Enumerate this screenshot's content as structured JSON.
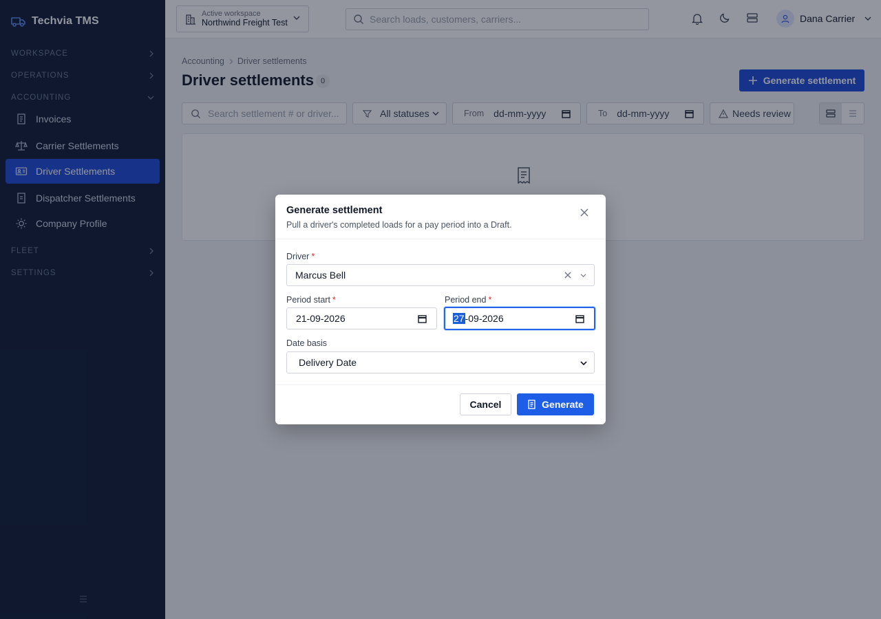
{
  "app": {
    "brand": "Techvia TMS"
  },
  "sidebar": {
    "sections": {
      "workspace": "WORKSPACE",
      "operations": "OPERATIONS",
      "accounting": "ACCOUNTING",
      "fleet": "FLEET",
      "settings": "SETTINGS"
    },
    "items": [
      {
        "label": "Invoices",
        "icon": "invoice-icon"
      },
      {
        "label": "Carrier Settlements",
        "icon": "scale-icon"
      },
      {
        "label": "Driver Settlements",
        "icon": "id-card-icon",
        "active": true
      },
      {
        "label": "Dispatcher Settlements",
        "icon": "document-icon"
      },
      {
        "label": "Company Profile",
        "icon": "sun-icon"
      }
    ]
  },
  "topbar": {
    "workspace_label": "Active workspace",
    "workspace_name": "Northwind Freight Test",
    "search_placeholder": "Search loads, customers, carriers...",
    "user_name": "Dana Carrier"
  },
  "page": {
    "breadcrumb": [
      "Accounting",
      "Driver settlements"
    ],
    "title": "Driver settlements",
    "count": "0",
    "generate_button": "Generate settlement",
    "filters": {
      "search_placeholder": "Search settlement # or driver...",
      "status": "All statuses",
      "from_label": "From",
      "from_value": "dd-mm-yyyy",
      "to_label": "To",
      "to_value": "dd-mm-yyyy",
      "needs_review": "Needs review"
    }
  },
  "modal": {
    "title": "Generate settlement",
    "subtitle": "Pull a driver's completed loads for a pay period into a Draft.",
    "driver_label": "Driver",
    "driver_value": "Marcus Bell",
    "period_start_label": "Period start",
    "period_start_value": "21-09-2026",
    "period_end_label": "Period end",
    "period_end_day": "27",
    "period_end_rest": "-09-2026",
    "date_basis_label": "Date basis",
    "date_basis_value": "Delivery Date",
    "required_mark": "*",
    "cancel": "Cancel",
    "generate": "Generate"
  },
  "colors": {
    "sidebar_bg": "#0f1a33",
    "accent": "#1e4bd8",
    "required": "#dc2626"
  }
}
